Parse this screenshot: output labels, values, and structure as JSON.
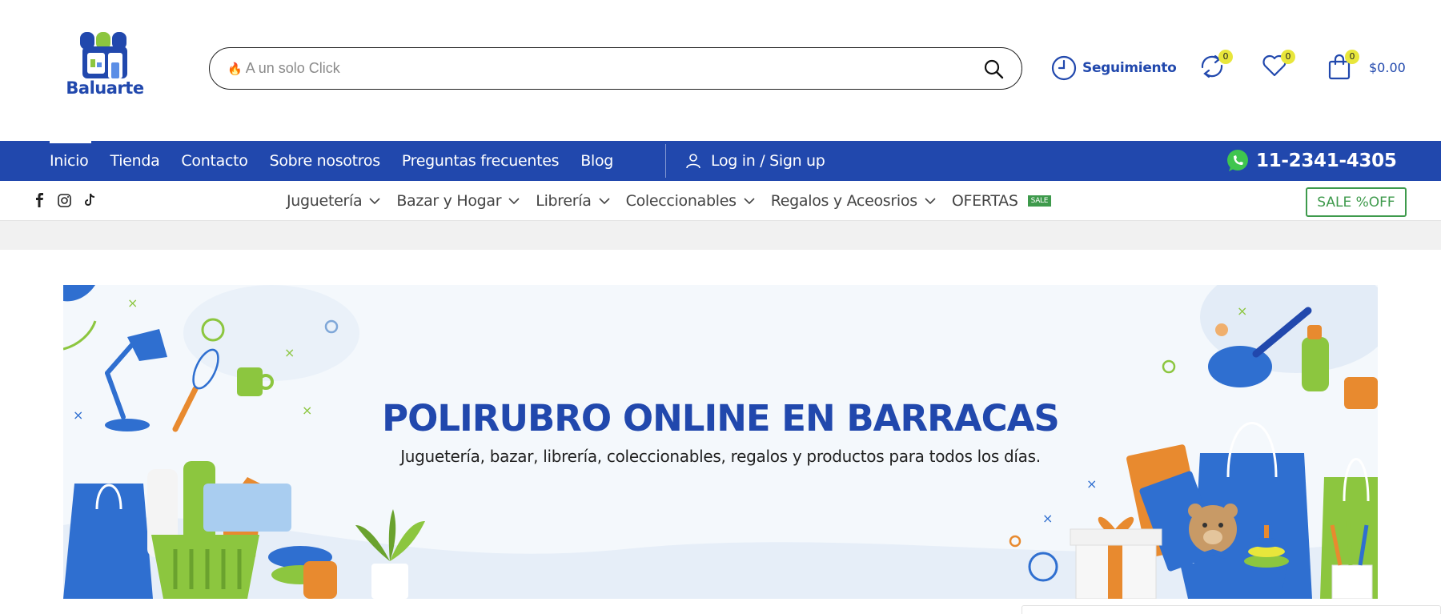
{
  "header": {
    "logo_text": "Baluarte",
    "search_placeholder": "A un solo Click",
    "tracking_label": "Seguimiento",
    "compare_count": "0",
    "wishlist_count": "0",
    "cart_count": "0",
    "cart_total": "$0.00"
  },
  "nav": {
    "items": [
      "Inicio",
      "Tienda",
      "Contacto",
      "Sobre nosotros",
      "Preguntas frecuentes",
      "Blog"
    ],
    "login": "Log in / Sign up",
    "phone": "11-2341-4305"
  },
  "categories": {
    "items": [
      "Juguetería",
      "Bazar y Hogar",
      "Librería",
      "Coleccionables",
      "Regalos y Aceosrios"
    ],
    "offers": "OFERTAS",
    "offers_tag": "SALE",
    "sale_button": "SALE %OFF"
  },
  "banner": {
    "title": "POLIRUBRO ONLINE EN BARRACAS",
    "subtitle": "Juguetería, bazar, librería, coleccionables, regalos y productos para todos los días."
  },
  "colors": {
    "brand_blue": "#2148ad",
    "accent_green": "#3e9a4c",
    "badge_yellow": "#e8e63b"
  }
}
